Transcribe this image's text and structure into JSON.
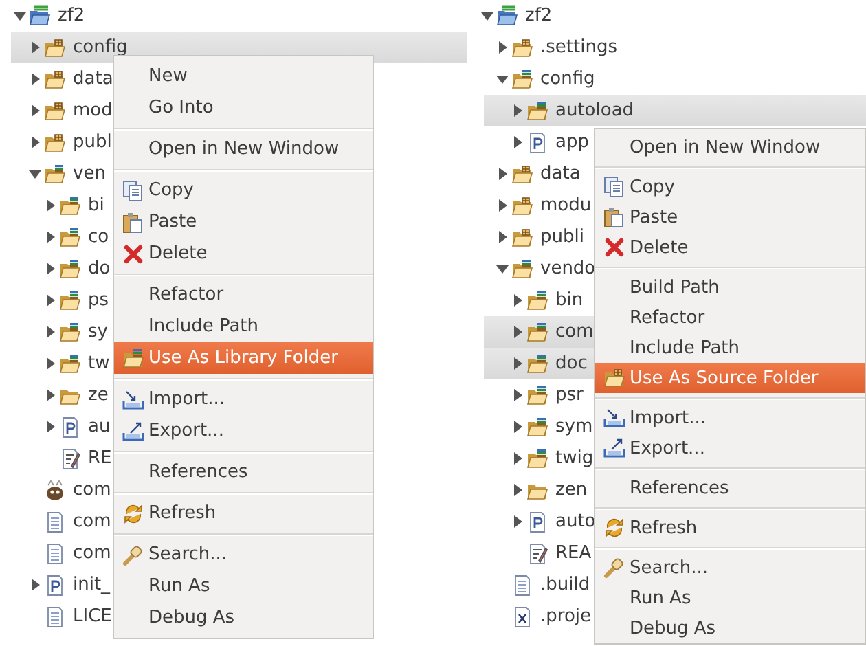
{
  "panels": [
    {
      "tree": [
        {
          "label": "zf2",
          "kind": "project",
          "expanded": true,
          "selected": false,
          "children": [
            {
              "label": "config",
              "kind": "source-folder",
              "expanded": false,
              "selected": true
            },
            {
              "label": "data",
              "kind": "source-folder",
              "expanded": false,
              "selected": false
            },
            {
              "label": "mod",
              "kind": "source-folder",
              "expanded": false,
              "selected": false
            },
            {
              "label": "publ",
              "kind": "source-folder",
              "expanded": false,
              "selected": false
            },
            {
              "label": "ven",
              "kind": "library-folder",
              "expanded": true,
              "selected": false,
              "children": [
                {
                  "label": "bi",
                  "kind": "library-folder",
                  "expanded": false,
                  "selected": false
                },
                {
                  "label": "co",
                  "kind": "library-folder",
                  "expanded": false,
                  "selected": false
                },
                {
                  "label": "do",
                  "kind": "library-folder",
                  "expanded": false,
                  "selected": false
                },
                {
                  "label": "ps",
                  "kind": "library-folder",
                  "expanded": false,
                  "selected": false
                },
                {
                  "label": "sy",
                  "kind": "library-folder",
                  "expanded": false,
                  "selected": false
                },
                {
                  "label": "tw",
                  "kind": "library-folder",
                  "expanded": false,
                  "selected": false
                },
                {
                  "label": "ze",
                  "kind": "folder",
                  "expanded": false,
                  "selected": false
                },
                {
                  "label": "au",
                  "kind": "php",
                  "expanded": false,
                  "selected": false
                },
                {
                  "label": "RE",
                  "kind": "readme",
                  "selected": false
                }
              ]
            },
            {
              "label": "com",
              "kind": "composer",
              "selected": false
            },
            {
              "label": "com",
              "kind": "file",
              "selected": false
            },
            {
              "label": "com",
              "kind": "file",
              "selected": false
            },
            {
              "label": "init_",
              "kind": "php",
              "expanded": false,
              "selected": false
            },
            {
              "label": "LICE",
              "kind": "file",
              "selected": false
            }
          ]
        }
      ],
      "menu": [
        {
          "kind": "plain",
          "label": "New",
          "selected": false
        },
        {
          "kind": "plain",
          "label": "Go Into",
          "selected": false
        },
        {
          "kind": "separator"
        },
        {
          "kind": "plain",
          "label": "Open in New Window",
          "selected": false
        },
        {
          "kind": "separator"
        },
        {
          "kind": "copy",
          "label": "Copy",
          "selected": false
        },
        {
          "kind": "paste",
          "label": "Paste",
          "selected": false
        },
        {
          "kind": "delete",
          "label": "Delete",
          "selected": false
        },
        {
          "kind": "separator"
        },
        {
          "kind": "plain",
          "label": "Refactor",
          "selected": false
        },
        {
          "kind": "plain",
          "label": "Include Path",
          "selected": false
        },
        {
          "kind": "library-folder",
          "label": "Use As Library Folder",
          "selected": true
        },
        {
          "kind": "separator"
        },
        {
          "kind": "import",
          "label": "Import...",
          "selected": false
        },
        {
          "kind": "export",
          "label": "Export...",
          "selected": false
        },
        {
          "kind": "separator"
        },
        {
          "kind": "plain",
          "label": "References",
          "selected": false
        },
        {
          "kind": "separator"
        },
        {
          "kind": "refresh",
          "label": "Refresh",
          "selected": false
        },
        {
          "kind": "separator"
        },
        {
          "kind": "search",
          "label": "Search...",
          "selected": false
        },
        {
          "kind": "plain",
          "label": "Run As",
          "selected": false
        },
        {
          "kind": "plain",
          "label": "Debug As",
          "selected": false
        }
      ]
    },
    {
      "tree": [
        {
          "label": "zf2",
          "kind": "project",
          "expanded": true,
          "selected": false,
          "children": [
            {
              "label": ".settings",
              "kind": "source-folder",
              "expanded": false,
              "selected": false
            },
            {
              "label": "config",
              "kind": "library-folder",
              "expanded": true,
              "selected": false,
              "children": [
                {
                  "label": "autoload",
                  "kind": "library-folder",
                  "expanded": false,
                  "selected": true
                },
                {
                  "label": "app",
                  "kind": "php",
                  "expanded": false,
                  "selected": false
                }
              ]
            },
            {
              "label": "data",
              "kind": "source-folder",
              "expanded": false,
              "selected": false
            },
            {
              "label": "modu",
              "kind": "source-folder",
              "expanded": false,
              "selected": false
            },
            {
              "label": "publi",
              "kind": "source-folder",
              "expanded": false,
              "selected": false
            },
            {
              "label": "vendo",
              "kind": "library-folder",
              "expanded": true,
              "selected": false,
              "children": [
                {
                  "label": "bin",
                  "kind": "library-folder",
                  "expanded": false,
                  "selected": false
                },
                {
                  "label": "com",
                  "kind": "library-folder",
                  "expanded": false,
                  "selected": true
                },
                {
                  "label": "doc",
                  "kind": "library-folder",
                  "expanded": false,
                  "selected": true
                },
                {
                  "label": "psr",
                  "kind": "library-folder",
                  "expanded": false,
                  "selected": false
                },
                {
                  "label": "sym",
                  "kind": "library-folder",
                  "expanded": false,
                  "selected": false
                },
                {
                  "label": "twig",
                  "kind": "library-folder",
                  "expanded": false,
                  "selected": false
                },
                {
                  "label": "zen",
                  "kind": "folder",
                  "expanded": false,
                  "selected": false
                },
                {
                  "label": "auto",
                  "kind": "php",
                  "expanded": false,
                  "selected": false
                },
                {
                  "label": "REA",
                  "kind": "readme",
                  "selected": false
                }
              ]
            },
            {
              "label": ".build",
              "kind": "file",
              "selected": false
            },
            {
              "label": ".proje",
              "kind": "xml",
              "selected": false
            }
          ]
        }
      ],
      "menu": [
        {
          "kind": "plain",
          "label": "Open in New Window",
          "selected": false
        },
        {
          "kind": "separator"
        },
        {
          "kind": "copy",
          "label": "Copy",
          "selected": false
        },
        {
          "kind": "paste",
          "label": "Paste",
          "selected": false
        },
        {
          "kind": "delete",
          "label": "Delete",
          "selected": false
        },
        {
          "kind": "separator"
        },
        {
          "kind": "plain",
          "label": "Build Path",
          "selected": false
        },
        {
          "kind": "plain",
          "label": "Refactor",
          "selected": false
        },
        {
          "kind": "plain",
          "label": "Include Path",
          "selected": false
        },
        {
          "kind": "source-folder",
          "label": "Use As Source Folder",
          "selected": true
        },
        {
          "kind": "separator"
        },
        {
          "kind": "import",
          "label": "Import...",
          "selected": false
        },
        {
          "kind": "export",
          "label": "Export...",
          "selected": false
        },
        {
          "kind": "separator"
        },
        {
          "kind": "plain",
          "label": "References",
          "selected": false
        },
        {
          "kind": "separator"
        },
        {
          "kind": "refresh",
          "label": "Refresh",
          "selected": false
        },
        {
          "kind": "separator"
        },
        {
          "kind": "search",
          "label": "Search...",
          "selected": false
        },
        {
          "kind": "plain",
          "label": "Run As",
          "selected": false
        },
        {
          "kind": "plain",
          "label": "Debug As",
          "selected": false
        }
      ]
    }
  ]
}
